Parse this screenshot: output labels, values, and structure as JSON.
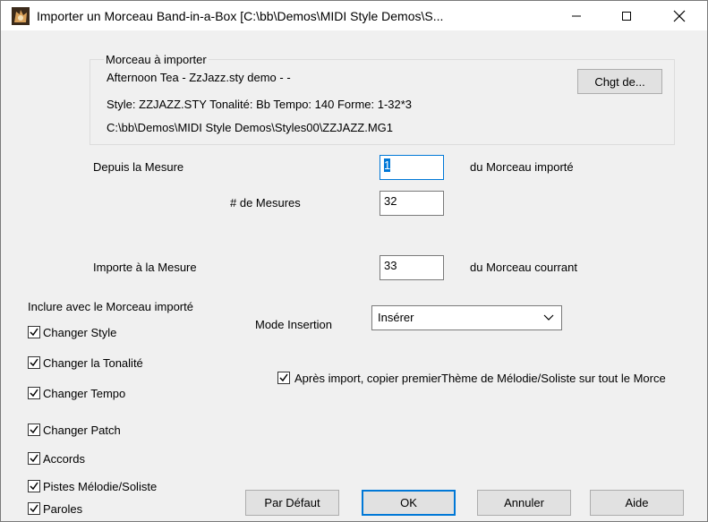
{
  "window": {
    "title": "Importer un Morceau Band-in-a-Box [C:\\bb\\Demos\\MIDI Style Demos\\S...",
    "controls": {
      "minimize": "—",
      "maximize": "☐",
      "close": "✕"
    }
  },
  "source": {
    "legend": "Morceau à importer",
    "song_title": "Afternoon Tea - ZzJazz.sty demo - -",
    "details": "Style: ZZJAZZ.STY  Tonalité: Bb   Tempo: 140  Forme: 1-32*3",
    "path": "C:\\bb\\Demos\\MIDI Style Demos\\Styles00\\ZZJAZZ.MG1",
    "change_button": "Chgt de..."
  },
  "fields": {
    "from_bar_label": "Depuis la Mesure",
    "from_bar_value": "1",
    "from_bar_suffix": "du Morceau importé",
    "num_bars_label": "# de Mesures",
    "num_bars_value": "32",
    "import_at_label": "Importe à la Mesure",
    "import_at_value": "33",
    "import_at_suffix": "du Morceau courrant"
  },
  "include": {
    "legend": "Inclure avec le Morceau importé",
    "items": [
      {
        "label": "Changer Style",
        "checked": true
      },
      {
        "label": "Changer la Tonalité",
        "checked": true
      },
      {
        "label": "Changer Tempo",
        "checked": true
      },
      {
        "label": "Changer Patch",
        "checked": true
      },
      {
        "label": "Accords",
        "checked": true
      },
      {
        "label": "Pistes Mélodie/Soliste",
        "checked": true
      },
      {
        "label": "Paroles",
        "checked": true
      }
    ]
  },
  "insert_mode": {
    "label": "Mode Insertion",
    "selected": "Insérer"
  },
  "copy_theme": {
    "label": "Après import, copier premierThème de Mélodie/Soliste sur tout le Morce",
    "checked": true
  },
  "buttons": {
    "defaults": "Par Défaut",
    "ok": "OK",
    "cancel": "Annuler",
    "help": "Aide"
  },
  "colors": {
    "accent": "#0078d7",
    "background": "#f0f0f0"
  }
}
